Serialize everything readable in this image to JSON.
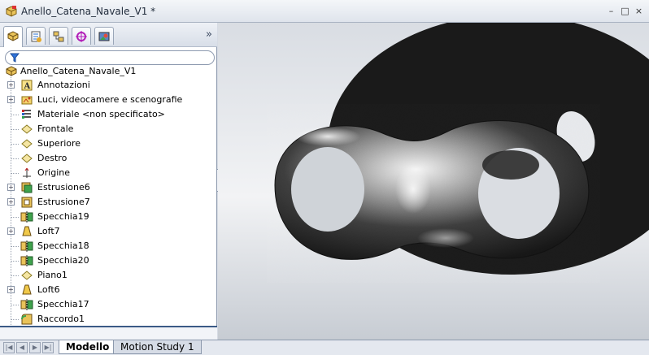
{
  "window": {
    "title": "Anello_Catena_Navale_V1 *",
    "buttons": [
      "–",
      "□",
      "×"
    ]
  },
  "panel": {
    "tabs": [
      {
        "name": "featuremanager-tab-icon",
        "active": true
      },
      {
        "name": "propertymanager-tab-icon",
        "active": false
      },
      {
        "name": "configurationmanager-tab-icon",
        "active": false
      },
      {
        "name": "dimxpert-tab-icon",
        "active": false
      },
      {
        "name": "display-manager-tab-icon",
        "active": false
      }
    ],
    "expand_chevron": "»",
    "tree": {
      "root": "Anello_Catena_Navale_V1",
      "items": [
        {
          "label": "Annotazioni",
          "icon": "annotations-icon",
          "expandable": true
        },
        {
          "label": "Luci, videocamere e scenografie",
          "icon": "lights-cameras-icon",
          "expandable": true
        },
        {
          "label": "Materiale <non specificato>",
          "icon": "material-icon",
          "expandable": false
        },
        {
          "label": "Frontale",
          "icon": "plane-icon",
          "expandable": false
        },
        {
          "label": "Superiore",
          "icon": "plane-icon",
          "expandable": false
        },
        {
          "label": "Destro",
          "icon": "plane-icon",
          "expandable": false
        },
        {
          "label": "Origine",
          "icon": "origin-icon",
          "expandable": false
        },
        {
          "label": "Estrusione6",
          "icon": "extrude-icon",
          "expandable": true
        },
        {
          "label": "Estrusione7",
          "icon": "extrude-icon",
          "expandable": true
        },
        {
          "label": "Specchia19",
          "icon": "mirror-icon",
          "expandable": false
        },
        {
          "label": "Loft7",
          "icon": "loft-icon",
          "expandable": true
        },
        {
          "label": "Specchia18",
          "icon": "mirror-icon",
          "expandable": false
        },
        {
          "label": "Specchia20",
          "icon": "mirror-icon",
          "expandable": false
        },
        {
          "label": "Piano1",
          "icon": "plane-icon",
          "expandable": false
        },
        {
          "label": "Loft6",
          "icon": "loft-icon",
          "expandable": true
        },
        {
          "label": "Specchia17",
          "icon": "mirror-icon",
          "expandable": false
        },
        {
          "label": "Raccordo1",
          "icon": "fillet-icon",
          "expandable": false
        }
      ]
    }
  },
  "bottom_tabs": [
    {
      "label": "Modello",
      "active": true
    },
    {
      "label": "Motion Study 1",
      "active": false
    }
  ],
  "colors": {
    "accent": "#3b5a86",
    "panel_bg": "#ffffff",
    "titlebar": "#dfe4ec"
  }
}
